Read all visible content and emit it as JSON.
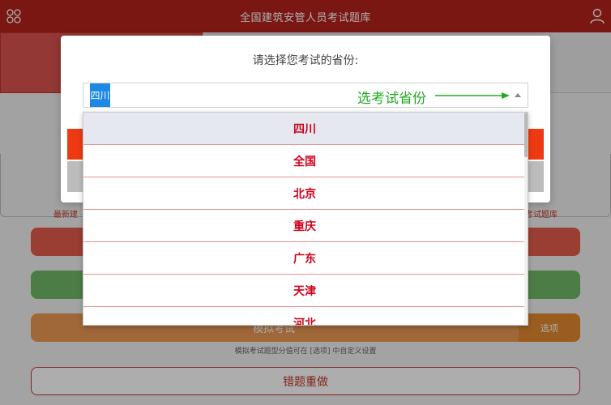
{
  "header": {
    "title": "全国建筑安管人员考试题库",
    "menu_icon": "grid-circles-icon",
    "user_icon": "user-icon"
  },
  "page": {
    "caption_left": "最新建",
    "caption_right": "考试题库",
    "mock_exam_label": "模拟考试",
    "options_label": "选项",
    "mock_note": "模拟考试题型分值可在 [选项] 中自定义设置",
    "wrong_redo_label": "错题重做"
  },
  "modal": {
    "title": "请选择您考试的省份:",
    "selected_value": "四川",
    "annotation": "选考试省份"
  },
  "dropdown": {
    "items": [
      "四川",
      "全国",
      "北京",
      "重庆",
      "广东",
      "天津",
      "河北"
    ],
    "selected_index": 0
  },
  "colors": {
    "header_bg": "#b4231b",
    "item_text": "#d0021b",
    "selected_bg": "#1e88e5",
    "annotation": "#22aa22"
  }
}
